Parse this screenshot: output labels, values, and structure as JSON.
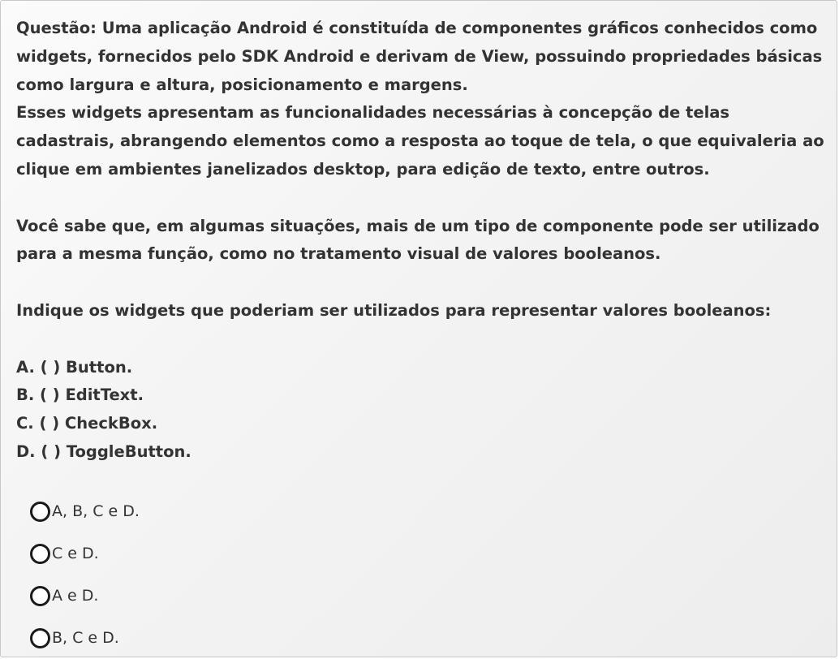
{
  "question": {
    "paragraph1": "Questão: Uma aplicação Android é constituída de componentes gráficos conhecidos como widgets, fornecidos pelo SDK Android e derivam de View, possuindo propriedades básicas como largura e altura, posicionamento e margens.",
    "paragraph2": "Esses widgets apresentam as funcionalidades necessárias à concepção de telas cadastrais, abrangendo elementos como a resposta ao toque de tela, o que equivaleria ao clique em ambientes janelizados desktop, para edição de texto, entre outros.",
    "paragraph3": "Você sabe que, em algumas situações, mais de um tipo de componente pode ser utilizado para a mesma função, como no tratamento visual de valores booleanos.",
    "prompt": "Indique os widgets que poderiam ser utilizados para representar valores booleanos:",
    "items": [
      "A. ( ) Button.",
      "B. ( ) EditText.",
      "C. ( ) CheckBox.",
      "D. ( ) ToggleButton."
    ]
  },
  "options": [
    {
      "label": "A, B, C e D.",
      "selected": false
    },
    {
      "label": "C e D.",
      "selected": false
    },
    {
      "label": "A e D.",
      "selected": false
    },
    {
      "label": "B, C e D.",
      "selected": false
    }
  ]
}
